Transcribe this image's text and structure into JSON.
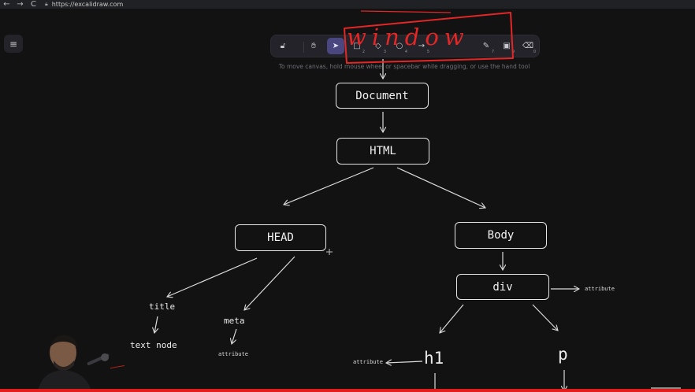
{
  "browser": {
    "back": "←",
    "forward": "→",
    "reload": "C",
    "url": "https://excalidraw.com"
  },
  "app": {
    "menu_icon": "≡",
    "hint": "To move canvas, hold mouse wheel or spacebar while dragging, or use the hand tool"
  },
  "toolbar": {
    "tools": [
      {
        "icon": "lock-icon",
        "glyph": "🔓︎",
        "key": ""
      },
      {
        "icon": "hand-icon",
        "glyph": "✋︎",
        "key": ""
      },
      {
        "icon": "pointer-icon",
        "glyph": "➤",
        "key": "",
        "active": true
      },
      {
        "icon": "rectangle-icon",
        "glyph": "□",
        "key": "2"
      },
      {
        "icon": "diamond-icon",
        "glyph": "◇",
        "key": "3"
      },
      {
        "icon": "ellipse-icon",
        "glyph": "○",
        "key": "4"
      },
      {
        "icon": "arrow-icon",
        "glyph": "→",
        "key": "5"
      },
      {
        "icon": "pen-icon",
        "glyph": "✎",
        "key": "7"
      },
      {
        "icon": "image-icon",
        "glyph": "▣",
        "key": "9"
      },
      {
        "icon": "eraser-icon",
        "glyph": "⌫",
        "key": "0"
      }
    ]
  },
  "diagram": {
    "document": "Document",
    "html": "HTML",
    "head": "HEAD",
    "body": "Body",
    "div": "div",
    "title": "title",
    "text_node": "text node",
    "meta": "meta",
    "attribute_meta": "attribute",
    "attribute_div": "attribute",
    "attribute_h1": "attribute",
    "h1": "h1",
    "p": "p",
    "annotation": "window"
  },
  "video": {
    "progress_fraction": 1.0
  }
}
